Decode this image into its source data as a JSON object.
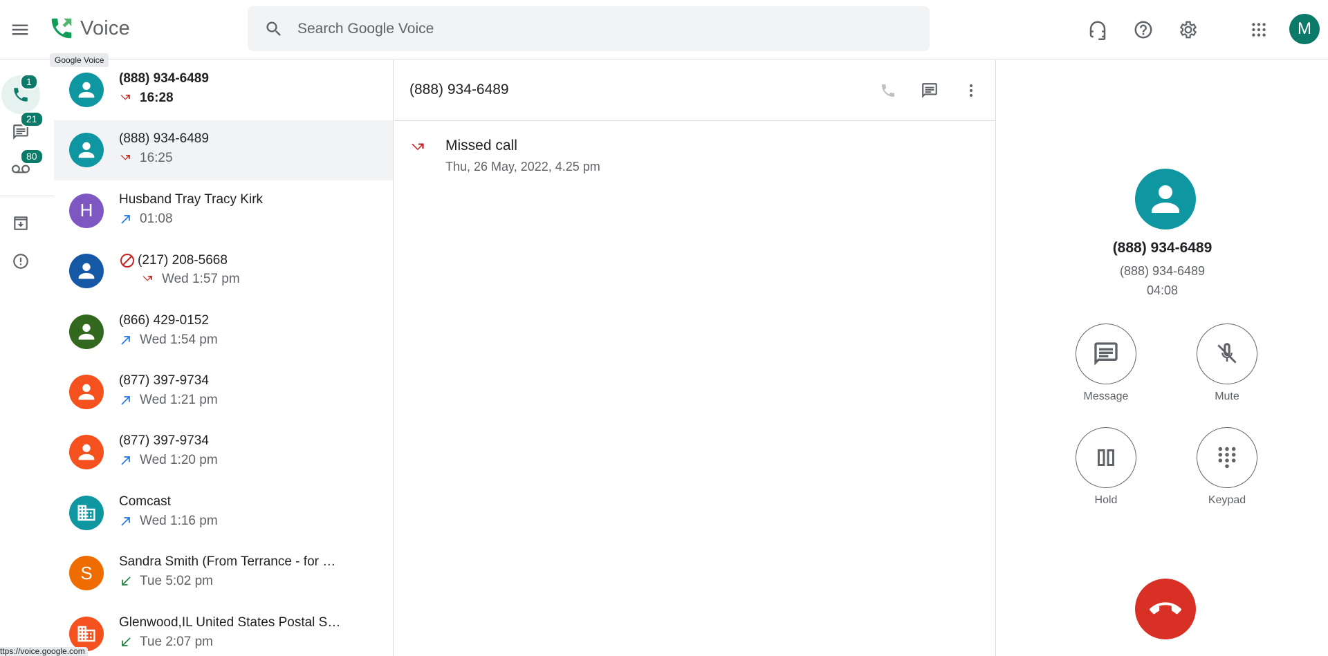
{
  "app": {
    "name": "Voice",
    "tooltip": "Google Voice",
    "account_initial": "M"
  },
  "search": {
    "placeholder": "Search Google Voice"
  },
  "nav": {
    "calls_badge": "1",
    "messages_badge": "21",
    "voicemail_badge": "80"
  },
  "list": [
    {
      "name": "(888) 934-6489",
      "time": "16:28",
      "type": "missed",
      "avatar": "person",
      "color": "#0f97a1",
      "bold": true,
      "selected": false,
      "blocked": false
    },
    {
      "name": "(888) 934-6489",
      "time": "16:25",
      "type": "missed",
      "avatar": "person",
      "color": "#0f97a1",
      "bold": false,
      "selected": true,
      "blocked": false
    },
    {
      "name": "Husband Tray Tracy Kirk",
      "time": "01:08",
      "type": "outgoing",
      "avatar": "H",
      "color": "#7e57c2",
      "bold": false,
      "selected": false,
      "blocked": false
    },
    {
      "name": "(217) 208-5668",
      "time": "Wed 1:57 pm",
      "type": "missed",
      "avatar": "person",
      "color": "#1558a5",
      "bold": false,
      "selected": false,
      "blocked": true
    },
    {
      "name": "(866) 429-0152",
      "time": "Wed 1:54 pm",
      "type": "outgoing",
      "avatar": "person",
      "color": "#33691e",
      "bold": false,
      "selected": false,
      "blocked": false
    },
    {
      "name": "(877) 397-9734",
      "time": "Wed 1:21 pm",
      "type": "outgoing",
      "avatar": "person",
      "color": "#f4511e",
      "bold": false,
      "selected": false,
      "blocked": false
    },
    {
      "name": "(877) 397-9734",
      "time": "Wed 1:20 pm",
      "type": "outgoing",
      "avatar": "person",
      "color": "#f4511e",
      "bold": false,
      "selected": false,
      "blocked": false
    },
    {
      "name": "Comcast",
      "time": "Wed 1:16 pm",
      "type": "outgoing",
      "avatar": "business",
      "color": "#0f97a1",
      "bold": false,
      "selected": false,
      "blocked": false
    },
    {
      "name": "Sandra Smith (From Terrance - for …",
      "time": "Tue 5:02 pm",
      "type": "incoming",
      "avatar": "S",
      "color": "#ef6c00",
      "bold": false,
      "selected": false,
      "blocked": false
    },
    {
      "name": "Glenwood,IL United States Postal S…",
      "time": "Tue 2:07 pm",
      "type": "incoming",
      "avatar": "business",
      "color": "#f4511e",
      "bold": false,
      "selected": false,
      "blocked": false
    }
  ],
  "detail": {
    "title": "(888) 934-6489",
    "entry_title": "Missed call",
    "entry_date": "Thu, 26 May, 2022, 4.25 pm"
  },
  "call": {
    "name": "(888) 934-6489",
    "number": "(888) 934-6489",
    "timer": "04:08",
    "message_label": "Message",
    "mute_label": "Mute",
    "hold_label": "Hold",
    "keypad_label": "Keypad"
  },
  "status": {
    "url": "ttps://voice.google.com"
  },
  "colors": {
    "accent": "#0b7a68",
    "missed": "#c5221f",
    "outgoing": "#1a73e8",
    "incoming": "#188038",
    "end_call": "#d93025"
  }
}
